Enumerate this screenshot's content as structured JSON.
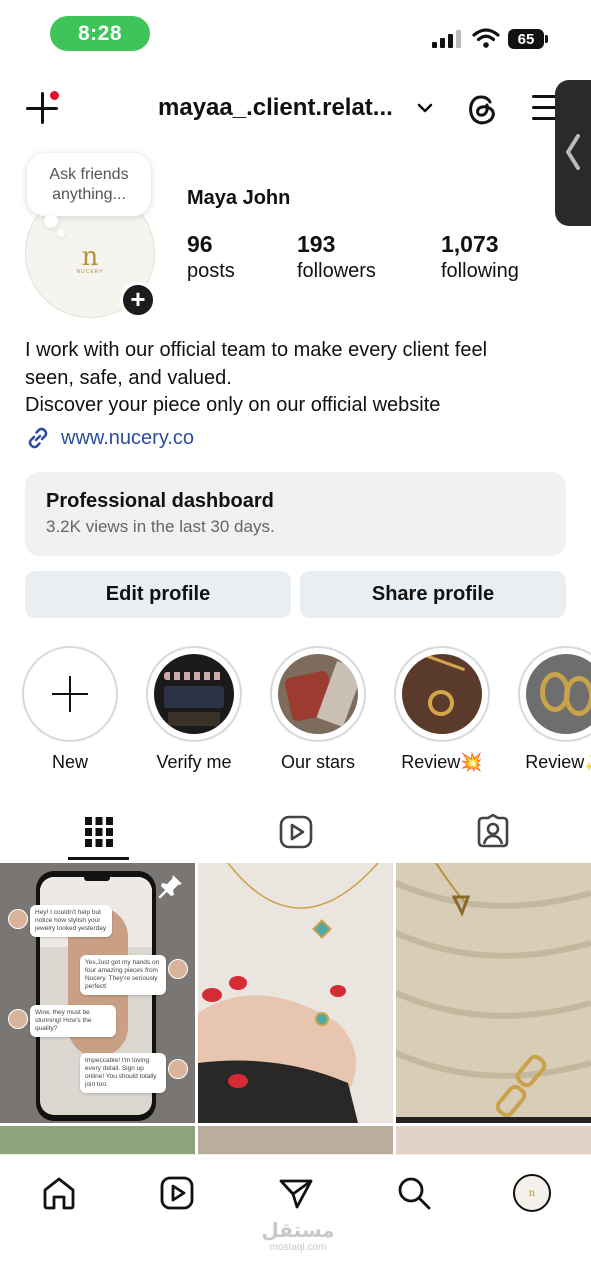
{
  "status_bar": {
    "time": "8:28",
    "battery": "65"
  },
  "header": {
    "username": "mayaa_.client.relat...",
    "icons": [
      "new-post-icon",
      "chevron-down-icon",
      "threads-icon",
      "menu-icon"
    ]
  },
  "profile": {
    "note": "Ask friends anything...",
    "avatar_logo": "n",
    "avatar_wordmark": "NUCERY",
    "display_name": "Maya John",
    "stats": [
      {
        "value": "96",
        "label": "posts"
      },
      {
        "value": "193",
        "label": "followers"
      },
      {
        "value": "1,073",
        "label": "following"
      }
    ],
    "bio_lines": [
      "I work with our official team to make every client feel",
      "seen, safe, and valued.",
      "Discover your piece only on our official website"
    ],
    "link": "www.nucery.co"
  },
  "dashboard": {
    "title": "Professional dashboard",
    "subtitle": "3.2K views in the last 30 days."
  },
  "buttons": {
    "edit": "Edit profile",
    "share": "Share profile"
  },
  "highlights": [
    {
      "label": "New"
    },
    {
      "label": "Verify me"
    },
    {
      "label": "Our stars"
    },
    {
      "label": "Review💥"
    },
    {
      "label": "Review✨"
    }
  ],
  "tabs": [
    "grid-icon",
    "reels-icon",
    "tagged-icon"
  ],
  "post1_chats": [
    "Hey! I couldn't help but notice how stylish your jewelry looked yesterday",
    "Yes,Just got my hands on four amazing pieces from Nucery. They're seriously perfect!",
    "Wow, they must be stunning! How's the quality?",
    "Impeccable! I'm loving every detail. Sign up online! You should totally join too."
  ],
  "bottom_nav": [
    "home-icon",
    "reels-icon",
    "messages-icon",
    "search-icon",
    "profile-avatar"
  ],
  "watermark": {
    "arabic": "مستقل",
    "latin": "mostaql.com"
  }
}
